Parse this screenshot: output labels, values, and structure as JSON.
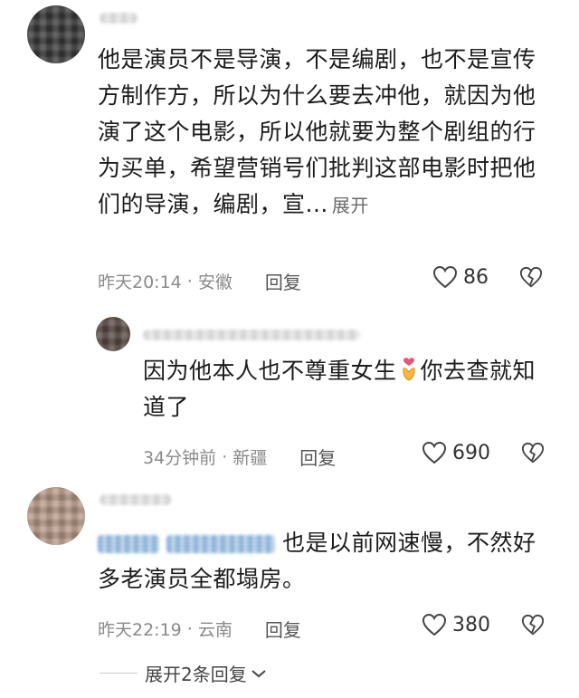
{
  "comments": [
    {
      "text_lines": [
        "他是演员不是导演，不是编剧，也不是宣传",
        "方制作方，所以为什么要去冲他，就因为他",
        "演了这个电影，所以他就要为整个剧组的行",
        "为买单，希望营销号们批判这部电影时把他",
        "们的导演，编剧，宣..."
      ],
      "expand_label": "展开",
      "time": "昨天20:14",
      "location": "安徽",
      "reply_label": "回复",
      "likes": "86"
    },
    {
      "text_before_emoji": "因为他本人也不尊重女生",
      "emoji": "heart-hands-emoji",
      "text_after_emoji": "你去查就知",
      "text_line2": "道了",
      "time": "34分钟前",
      "location": "新疆",
      "reply_label": "回复",
      "likes": "690"
    },
    {
      "text_line1": "也是以前网速慢，不然好",
      "text_line2": "多老演员全都塌房。",
      "time": "昨天22:19",
      "location": "云南",
      "reply_label": "回复",
      "likes": "380"
    }
  ],
  "expand_replies_label": "展开2条回复",
  "separator": "·"
}
